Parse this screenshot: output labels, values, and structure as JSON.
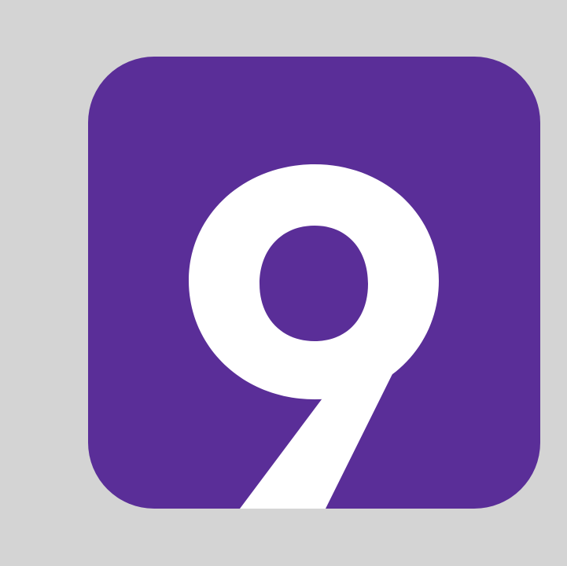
{
  "icon": {
    "name": "nine-app-icon",
    "glyph": "9",
    "background_color": "#5a2e98",
    "glyph_color": "#ffffff",
    "page_background": "#d4d4d4"
  }
}
